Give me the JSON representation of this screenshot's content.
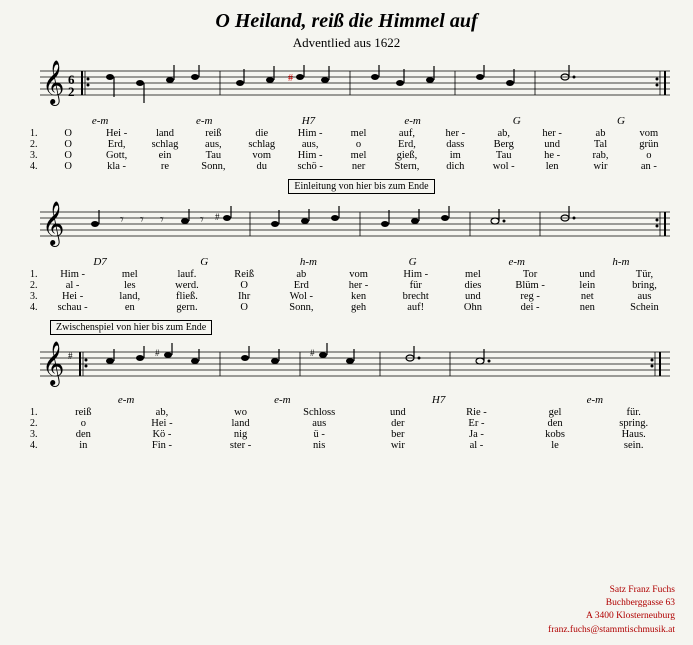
{
  "title": "O Heiland, reiß die Himmel auf",
  "subtitle": "Adventlied aus 1622",
  "section1_label": "Einleitung von hier bis zum Ende",
  "section2_label": "Zwischenspiel von hier bis zum Ende",
  "chords_row1": [
    "e-m",
    "",
    "e-m",
    "",
    "H7",
    "",
    "e-m",
    "",
    "G",
    "",
    "G"
  ],
  "chords_row2": [
    "D7",
    "",
    "G",
    "",
    "h-m",
    "",
    "G",
    "",
    "e-m",
    "",
    "h-m"
  ],
  "chords_row3": [
    "e-m",
    "",
    "",
    "",
    "e-m",
    "",
    "",
    "",
    "H7",
    "",
    "e-m"
  ],
  "lyrics": {
    "verse1_row1": [
      "O",
      "Hei-",
      "land",
      "reiß",
      "die",
      "Him-",
      "mel",
      "auf,",
      "her-",
      "ab,",
      "her-",
      "ab",
      "vom"
    ],
    "verse2_row1": [
      "O",
      "Erd,",
      "schlag",
      "aus,",
      "schlag",
      "aus,",
      "o",
      "Erd,",
      "dass",
      "Berg",
      "und",
      "Tal",
      "grün"
    ],
    "verse3_row1": [
      "O",
      "Gott,",
      "ein",
      "Tau",
      "vom",
      "Him-",
      "mel",
      "gieß,",
      "im",
      "Tau",
      "he-",
      "rab,",
      "o"
    ],
    "verse4_row1": [
      "O",
      "kla-",
      "re",
      "Sonn,",
      "du",
      "schö-",
      "ner",
      "Stern,",
      "dich",
      "wol-",
      "len",
      "wir",
      "an-"
    ],
    "verse1_row2": [
      "Him-",
      "mel",
      "lauf.",
      "Reiß",
      "ab",
      "vom",
      "Him-",
      "mel",
      "Tor",
      "und",
      "Tür,"
    ],
    "verse2_row2": [
      "al-",
      "les",
      "werd.",
      "O",
      "Erd",
      "her-",
      "für",
      "dies",
      "Blüm-",
      "lein",
      "bring,"
    ],
    "verse3_row2": [
      "Hei-",
      "land,",
      "fließ.",
      "Ihr",
      "Wol-",
      "ken",
      "brecht",
      "und",
      "reg-",
      "net",
      "aus"
    ],
    "verse4_row2": [
      "schau-",
      "en",
      "gern.",
      "O",
      "Sonn,",
      "geh",
      "auf!",
      "Ohn",
      "dei-",
      "nen",
      "Schein"
    ],
    "verse1_row3": [
      "reiß",
      "ab,",
      "wo",
      "Schloss",
      "und",
      "Rie-",
      "gel",
      "für."
    ],
    "verse2_row3": [
      "o",
      "Hei-",
      "land",
      "aus",
      "der",
      "Er-",
      "den",
      "spring."
    ],
    "verse3_row3": [
      "den",
      "Kö-",
      "nig",
      "ü-",
      "ber",
      "Ja-",
      "kobs",
      "Haus."
    ],
    "verse4_row3": [
      "in",
      "Fin-",
      "ster-",
      "nis",
      "wir",
      "al-",
      "le",
      "sein."
    ]
  },
  "footer": {
    "line1": "Satz Franz Fuchs",
    "line2": "Buchberggasse 63",
    "line3": "A 3400 Klosterneuburg",
    "line4": "franz.fuchs@stammtischmusik.at"
  }
}
